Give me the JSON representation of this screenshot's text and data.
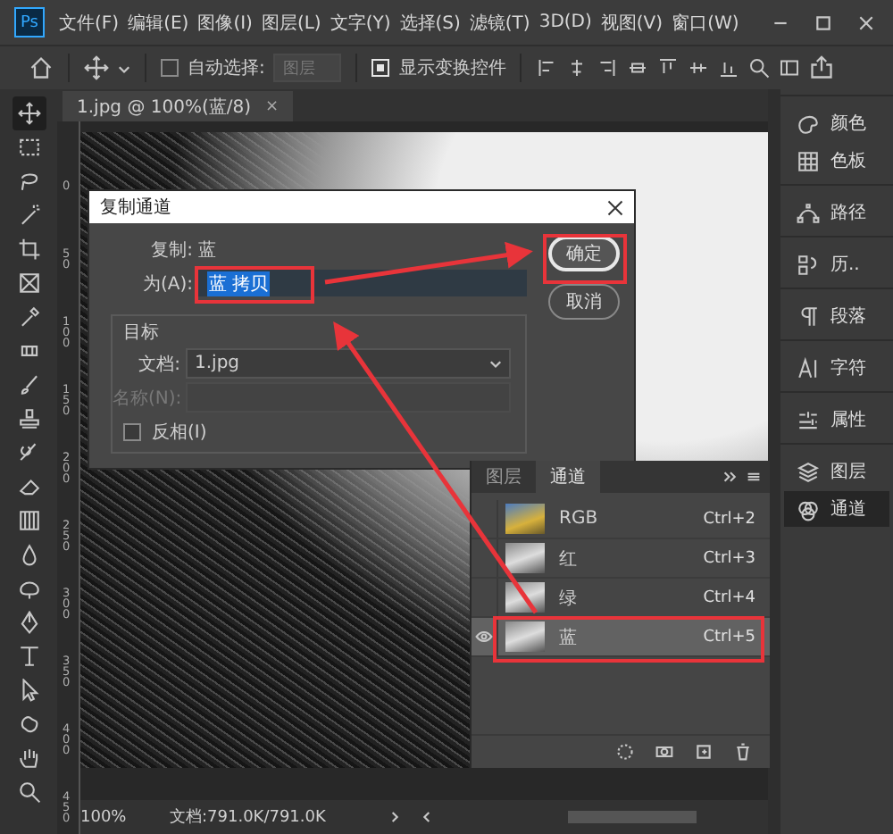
{
  "app": {
    "logo": "Ps"
  },
  "menu": [
    "文件(F)",
    "编辑(E)",
    "图像(I)",
    "图层(L)",
    "文字(Y)",
    "选择(S)",
    "滤镜(T)",
    "3D(D)",
    "视图(V)",
    "窗口(W)"
  ],
  "options_bar": {
    "auto_select": {
      "label": "自动选择:",
      "checked": false
    },
    "target": {
      "value": "图层"
    },
    "show_transform": {
      "label": "显示变换控件",
      "checked": true
    }
  },
  "document_tab": {
    "title": "1.jpg @ 100%(蓝/8)",
    "close": "×"
  },
  "ruler_marks": [
    "0",
    "50",
    "100",
    "150",
    "200",
    "250",
    "300",
    "350",
    "400",
    "450"
  ],
  "dialog": {
    "title": "复制通道",
    "source_label": "复制:",
    "source": "蓝",
    "as_label": "为(A):",
    "as_value": "蓝 拷贝",
    "group_title": "目标",
    "doc_label": "文档:",
    "doc_value": "1.jpg",
    "name_label": "名称(N):",
    "name_disabled": true,
    "invert": {
      "label": "反相(I)",
      "checked": false
    },
    "buttons": [
      {
        "label": "确定",
        "default": true
      },
      {
        "label": "取消",
        "default": false
      }
    ]
  },
  "channels_panel": {
    "tabs": [
      {
        "label": "图层",
        "selected": false
      },
      {
        "label": "通道",
        "selected": true
      }
    ],
    "channels": [
      {
        "name": "RGB",
        "shortcut": "Ctrl+2",
        "kind": "composite",
        "visible": false,
        "selected": false
      },
      {
        "name": "红",
        "shortcut": "Ctrl+3",
        "kind": "single",
        "visible": false,
        "selected": false
      },
      {
        "name": "绿",
        "shortcut": "Ctrl+4",
        "kind": "single",
        "visible": false,
        "selected": false
      },
      {
        "name": "蓝",
        "shortcut": "Ctrl+5",
        "kind": "single",
        "visible": true,
        "selected": true
      }
    ]
  },
  "dock": [
    {
      "items": [
        {
          "label": "颜色",
          "kind": "color",
          "selected": false
        },
        {
          "label": "色板",
          "kind": "swatches",
          "selected": false
        }
      ]
    },
    {
      "items": [
        {
          "label": "路径",
          "kind": "paths",
          "selected": false
        }
      ]
    },
    {
      "items": [
        {
          "label": "历..",
          "kind": "history",
          "selected": false
        }
      ]
    },
    {
      "items": [
        {
          "label": "段落",
          "kind": "paragraph",
          "selected": false
        }
      ]
    },
    {
      "items": [
        {
          "label": "字符",
          "kind": "character",
          "selected": false
        }
      ]
    },
    {
      "items": [
        {
          "label": "属性",
          "kind": "properties",
          "selected": false
        }
      ]
    },
    {
      "items": [
        {
          "label": "图层",
          "kind": "layers",
          "selected": false
        },
        {
          "label": "通道",
          "kind": "channels",
          "selected": true
        }
      ]
    }
  ],
  "status_bar": {
    "zoom": "100%",
    "doc_info": "文档:791.0K/791.0K"
  }
}
